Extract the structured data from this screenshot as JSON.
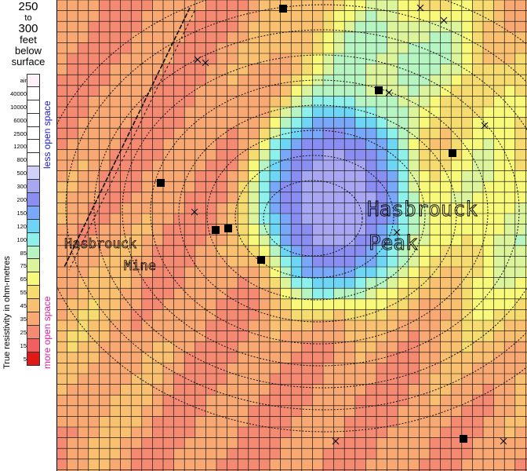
{
  "depth": {
    "from": "250",
    "to_word": "to",
    "to": "300",
    "unit": "feet",
    "line3": "below",
    "line4": "surface"
  },
  "legend": {
    "axis_label": "True resistivity in ohm-metres",
    "less": "less open space",
    "more": "more open space",
    "levels": [
      {
        "label": "air",
        "color": "#fdf0f8"
      },
      {
        "label": "40000",
        "color": "#ffffff"
      },
      {
        "label": "10000",
        "color": "#ffffff"
      },
      {
        "label": "6000",
        "color": "#ffffff"
      },
      {
        "label": "2500",
        "color": "#ffffff"
      },
      {
        "label": "1200",
        "color": "#ffffff"
      },
      {
        "label": "800",
        "color": "#ffffff"
      },
      {
        "label": "500",
        "color": "#d0d0f8"
      },
      {
        "label": "300",
        "color": "#a8a8f2"
      },
      {
        "label": "200",
        "color": "#8a8ef0"
      },
      {
        "label": "150",
        "color": "#7aa8f8"
      },
      {
        "label": "120",
        "color": "#6ed6f4"
      },
      {
        "label": "100",
        "color": "#8ef0ea"
      },
      {
        "label": "85",
        "color": "#b6f5c2"
      },
      {
        "label": "75",
        "color": "#dcf59c"
      },
      {
        "label": "65",
        "color": "#f8f87a"
      },
      {
        "label": "55",
        "color": "#f6dc70"
      },
      {
        "label": "45",
        "color": "#f8c070"
      },
      {
        "label": "35",
        "color": "#f8a872"
      },
      {
        "label": "25",
        "color": "#f48a72"
      },
      {
        "label": "15",
        "color": "#f06060"
      },
      {
        "label": "5",
        "color": "#e01818"
      }
    ]
  },
  "map": {
    "labels": [
      "Hasbrouck",
      "Peak",
      "Hasbrouck",
      "Mine"
    ]
  }
}
